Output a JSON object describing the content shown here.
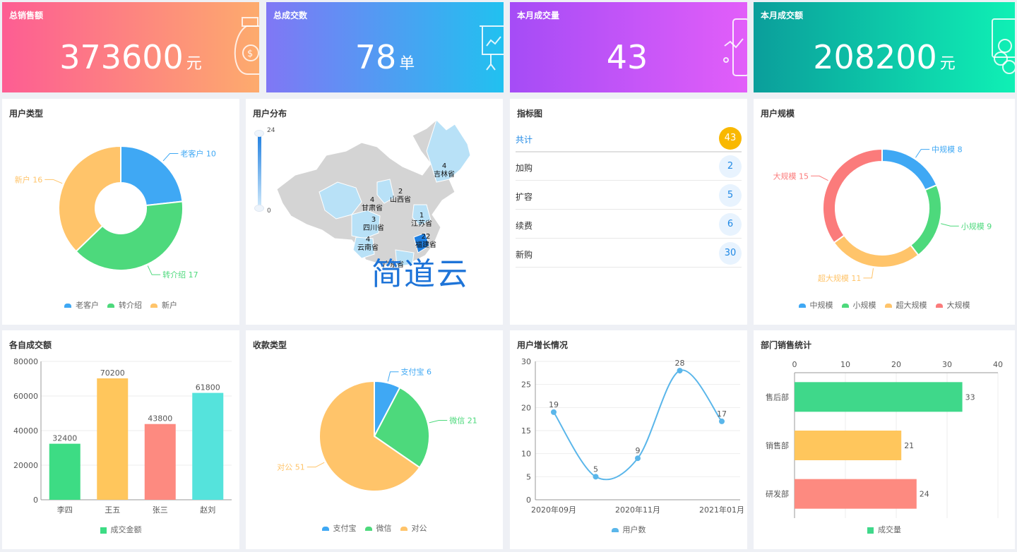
{
  "stats": [
    {
      "title": "总销售额",
      "value": "373600",
      "unit": "元",
      "icon": "money-bag-icon"
    },
    {
      "title": "总成交数",
      "value": "78",
      "unit": "单",
      "icon": "presentation-board-icon"
    },
    {
      "title": "本月成交量",
      "value": "43",
      "unit": "",
      "icon": "mobile-chart-icon"
    },
    {
      "title": "本月成交额",
      "value": "208200",
      "unit": "元",
      "icon": "coins-icon"
    }
  ],
  "titles": {
    "user_type": "用户类型",
    "user_dist": "用户分布",
    "indicator": "指标图",
    "user_scale": "用户规模",
    "each_amount": "各自成交额",
    "payment_type": "收款类型",
    "user_growth": "用户增长情况",
    "dept_sales": "部门销售统计"
  },
  "map": {
    "range_max": "24",
    "range_min": "0",
    "watermark": "简道云",
    "labels": [
      {
        "num": "4",
        "name": "吉林省"
      },
      {
        "num": "2",
        "name": "山西省"
      },
      {
        "num": "4",
        "name": "甘肃省"
      },
      {
        "num": "1",
        "name": "江苏省"
      },
      {
        "num": "3",
        "name": "四川省"
      },
      {
        "num": "4",
        "name": "云南省"
      },
      {
        "num": "22",
        "name": "福建省"
      },
      {
        "num": "",
        "name": "广东省"
      }
    ]
  },
  "indicator": {
    "rows": [
      {
        "label": "共计",
        "value": "43"
      },
      {
        "label": "加购",
        "value": "2"
      },
      {
        "label": "扩容",
        "value": "5"
      },
      {
        "label": "续费",
        "value": "6"
      },
      {
        "label": "新购",
        "value": "30"
      }
    ]
  },
  "chart_data": [
    {
      "type": "pie",
      "title": "用户类型",
      "donut": true,
      "categories": [
        "老客户",
        "转介绍",
        "新户"
      ],
      "values": [
        10,
        17,
        16
      ],
      "colors": [
        "#3fa8f4",
        "#4dd97c",
        "#ffc46a"
      ],
      "legend": "bottom"
    },
    {
      "type": "pie",
      "title": "用户规模",
      "donut": true,
      "categories": [
        "中规模",
        "小规模",
        "超大规模",
        "大规模"
      ],
      "values": [
        8,
        9,
        11,
        15
      ],
      "colors": [
        "#3fa8f4",
        "#4dd97c",
        "#ffc46a",
        "#fb7b7b"
      ],
      "legend": "bottom"
    },
    {
      "type": "bar",
      "title": "各自成交额",
      "categories": [
        "李四",
        "王五",
        "张三",
        "赵刘"
      ],
      "values": [
        32400,
        70200,
        43800,
        61800
      ],
      "series_name": "成交金额",
      "ylim": [
        0,
        80000
      ],
      "yticks": [
        0,
        20000,
        40000,
        60000,
        80000
      ],
      "colors": [
        "#3ddc84",
        "#ffc65c",
        "#fd8a80",
        "#55e3dc"
      ],
      "legend": "bottom"
    },
    {
      "type": "pie",
      "title": "收款类型",
      "donut": false,
      "categories": [
        "支付宝",
        "微信",
        "对公"
      ],
      "values": [
        6,
        21,
        51
      ],
      "colors": [
        "#3fa8f4",
        "#4dd97c",
        "#ffc46a"
      ],
      "legend": "bottom"
    },
    {
      "type": "line",
      "title": "用户增长情况",
      "x": [
        "2020年09月",
        "2020年10月",
        "2020年11月",
        "2020年12月",
        "2021年01月"
      ],
      "xtick_labels": [
        "2020年09月",
        "",
        "2020年11月",
        "",
        "2021年01月"
      ],
      "series": [
        {
          "name": "用户数",
          "values": [
            19,
            5,
            9,
            28,
            17
          ]
        }
      ],
      "ylim": [
        0,
        30
      ],
      "yticks": [
        0,
        5,
        10,
        15,
        20,
        25,
        30
      ],
      "color": "#5ab6ea",
      "legend": "bottom"
    },
    {
      "type": "bar",
      "orientation": "horizontal",
      "title": "部门销售统计",
      "categories": [
        "售后部",
        "销售部",
        "研发部"
      ],
      "values": [
        33,
        21,
        24
      ],
      "series_name": "成交量",
      "xlim": [
        0,
        40
      ],
      "xticks": [
        0,
        10,
        20,
        30,
        40
      ],
      "colors": [
        "#3fd88a",
        "#ffc65c",
        "#fd8a80"
      ],
      "legend": "bottom"
    }
  ]
}
